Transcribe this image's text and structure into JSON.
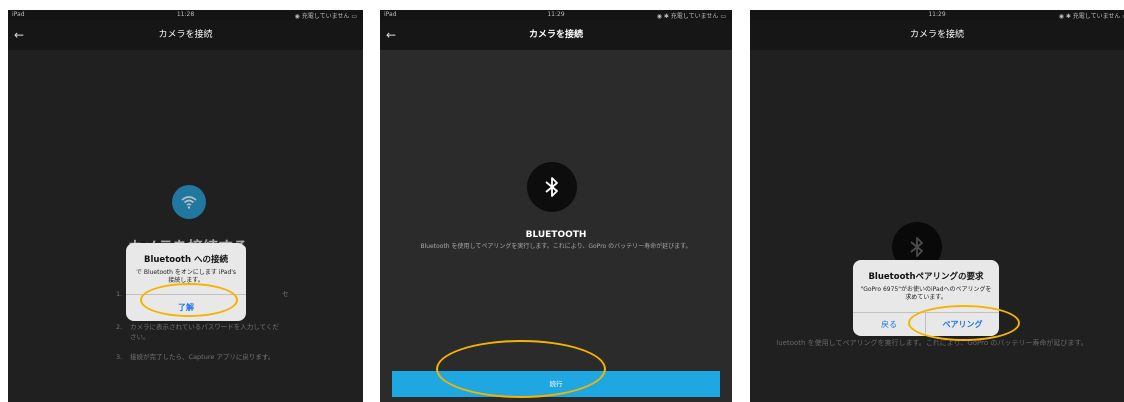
{
  "panel1": {
    "status": {
      "device": "iPad",
      "time": "11:28",
      "right": "◉ 充電していません ▭"
    },
    "nav": {
      "title": "カメラを接続",
      "back": "←"
    },
    "heading": "カメラを接続する",
    "steps": [
      {
        "num": "1.",
        "text": "セ"
      },
      {
        "num": "2.",
        "text": "カメラに表示されているパスワードを入力してください。"
      },
      {
        "num": "3.",
        "text": "接続が完了したら、Capture アプリに戻ります。"
      }
    ],
    "alert": {
      "title": "Bluetooth への接続",
      "message": "で Bluetooth をオンにします iPad's 接続します。",
      "button": "了解"
    },
    "icon": "wifi-icon"
  },
  "panel2": {
    "status": {
      "device": "iPad",
      "time": "11:29",
      "right": "◉ ✱ 充電していません ▭"
    },
    "nav": {
      "title": "カメラを接続",
      "back": "←"
    },
    "icon": "bluetooth-icon",
    "heading": "BLUETOOTH",
    "description": "Bluetooth を使用してペアリングを実行します。これにより、GoPro のバッテリー寿命が延びます。",
    "continue_label": "続行"
  },
  "panel3": {
    "status": {
      "time": "11:29",
      "right": "◉ ✱ 充電していません ▭"
    },
    "nav": {
      "title": "カメラを接続"
    },
    "description": "luetooth を使用してペアリングを実行します。これにより、GoPro のバッテリー寿命が延びます。",
    "alert": {
      "title": "Bluetoothペアリングの要求",
      "message": "\"GoPro 6975\"がお使いのiPadへのペアリングを求めています。",
      "cancel": "戻る",
      "confirm": "ペアリング"
    },
    "icon": "bluetooth-icon"
  },
  "highlight_color": "#f5b400",
  "accent_color": "#1ea7e0"
}
